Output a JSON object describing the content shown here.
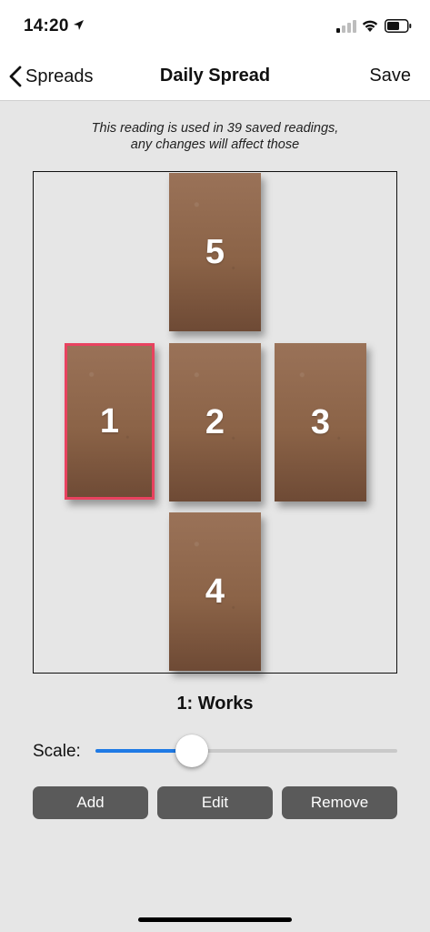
{
  "status": {
    "time": "14:20"
  },
  "nav": {
    "back_label": "Spreads",
    "title": "Daily Spread",
    "save_label": "Save"
  },
  "notice": {
    "line1": "This reading is used in 39 saved readings,",
    "line2": "any changes will affect those"
  },
  "cards": [
    {
      "number": "5"
    },
    {
      "number": "1",
      "selected": true
    },
    {
      "number": "2"
    },
    {
      "number": "3"
    },
    {
      "number": "4"
    }
  ],
  "selected_position": {
    "label": "1: Works"
  },
  "scale": {
    "label": "Scale:",
    "value": 0.32
  },
  "buttons": {
    "add": "Add",
    "edit": "Edit",
    "remove": "Remove"
  },
  "colors": {
    "accent": "#1f7ae5",
    "selected_outline": "#e8425f",
    "button_bg": "#5a5a5a",
    "card": "#8b6347"
  },
  "icons": [
    "location-arrow-icon",
    "cellular-signal-icon",
    "wifi-icon",
    "battery-icon",
    "chevron-left-icon"
  ]
}
